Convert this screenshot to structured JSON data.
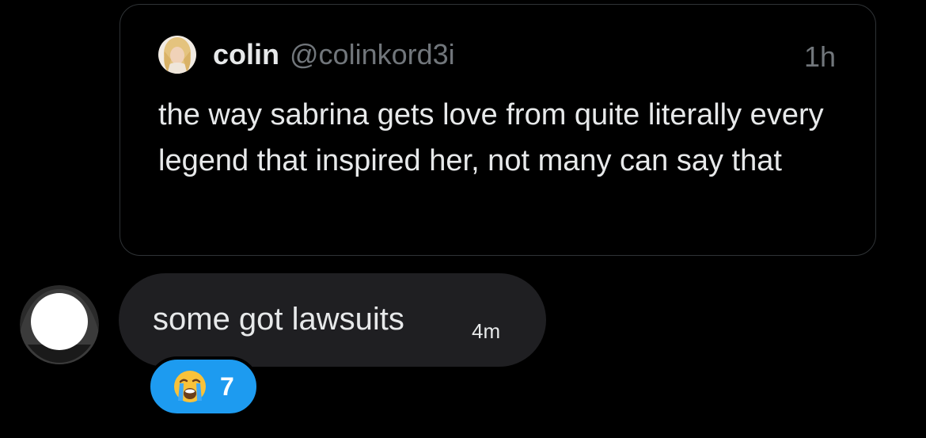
{
  "quoted_post": {
    "author_name": "colin",
    "author_handle": "@colinkord3i",
    "timestamp": "1h",
    "text": "the way sabrina gets love from quite literally every legend that inspired her, not many can say that"
  },
  "message": {
    "text": "some got lawsuits",
    "timestamp": "4m",
    "avatar_icon": "redacted-avatar"
  },
  "reaction": {
    "emoji_icon": "loudly-crying-face-icon",
    "count": "7"
  },
  "colors": {
    "background": "#000000",
    "bubble": "#1f1f22",
    "reaction_pill": "#1d9bf0",
    "card_border": "#2f3336",
    "secondary_text": "#71767b"
  }
}
